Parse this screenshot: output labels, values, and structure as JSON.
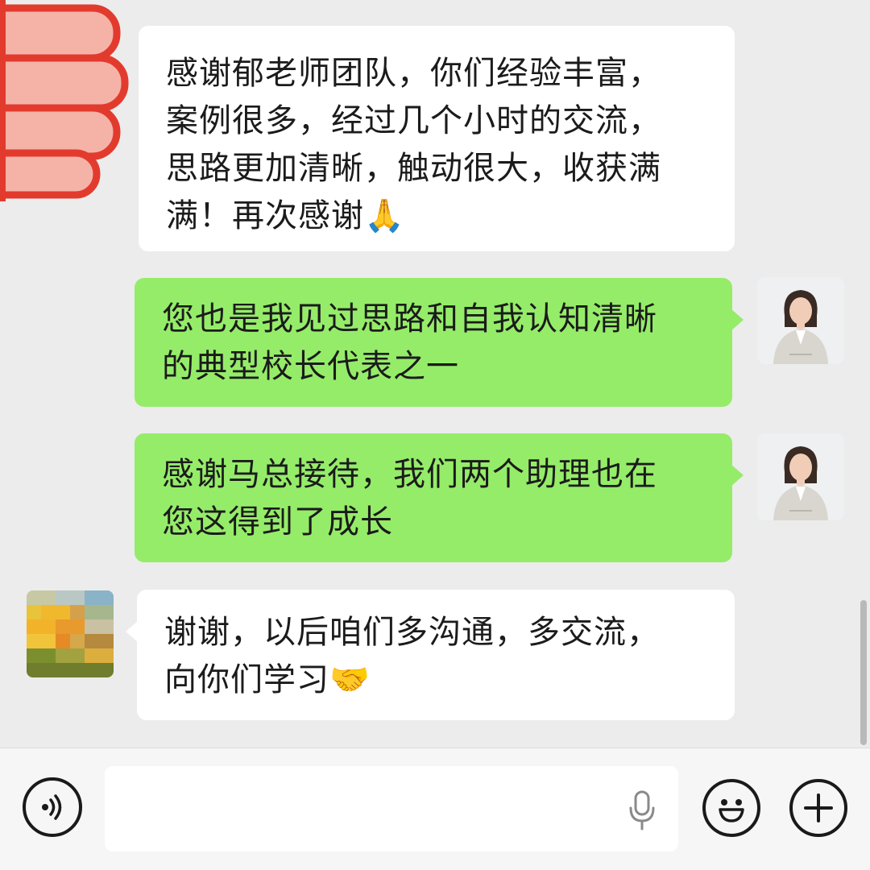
{
  "messages": [
    {
      "side": "incoming",
      "text": "感谢郁老师团队，你们经验丰富，\n案例很多，经过几个小时的交流，\n思路更加清晰，触动很大，收获满\n满！再次感谢🙏"
    },
    {
      "side": "outgoing",
      "text": "您也是我见过思路和自我认知清晰\n的典型校长代表之一"
    },
    {
      "side": "outgoing",
      "text": "感谢马总接待，我们两个助理也在\n您这得到了成长"
    },
    {
      "side": "incoming",
      "text": "谢谢，以后咱们多沟通，多交流，\n向你们学习🤝"
    }
  ],
  "input": {
    "value": "",
    "voice_icon": "voice-icon",
    "mic_icon": "microphone-icon",
    "emoji_icon": "emoji-icon",
    "plus_icon": "plus-icon"
  },
  "colors": {
    "chat_background": "#ececec",
    "outgoing_bubble": "#95ec69",
    "incoming_bubble": "#ffffff",
    "input_bar": "#f6f6f6"
  }
}
